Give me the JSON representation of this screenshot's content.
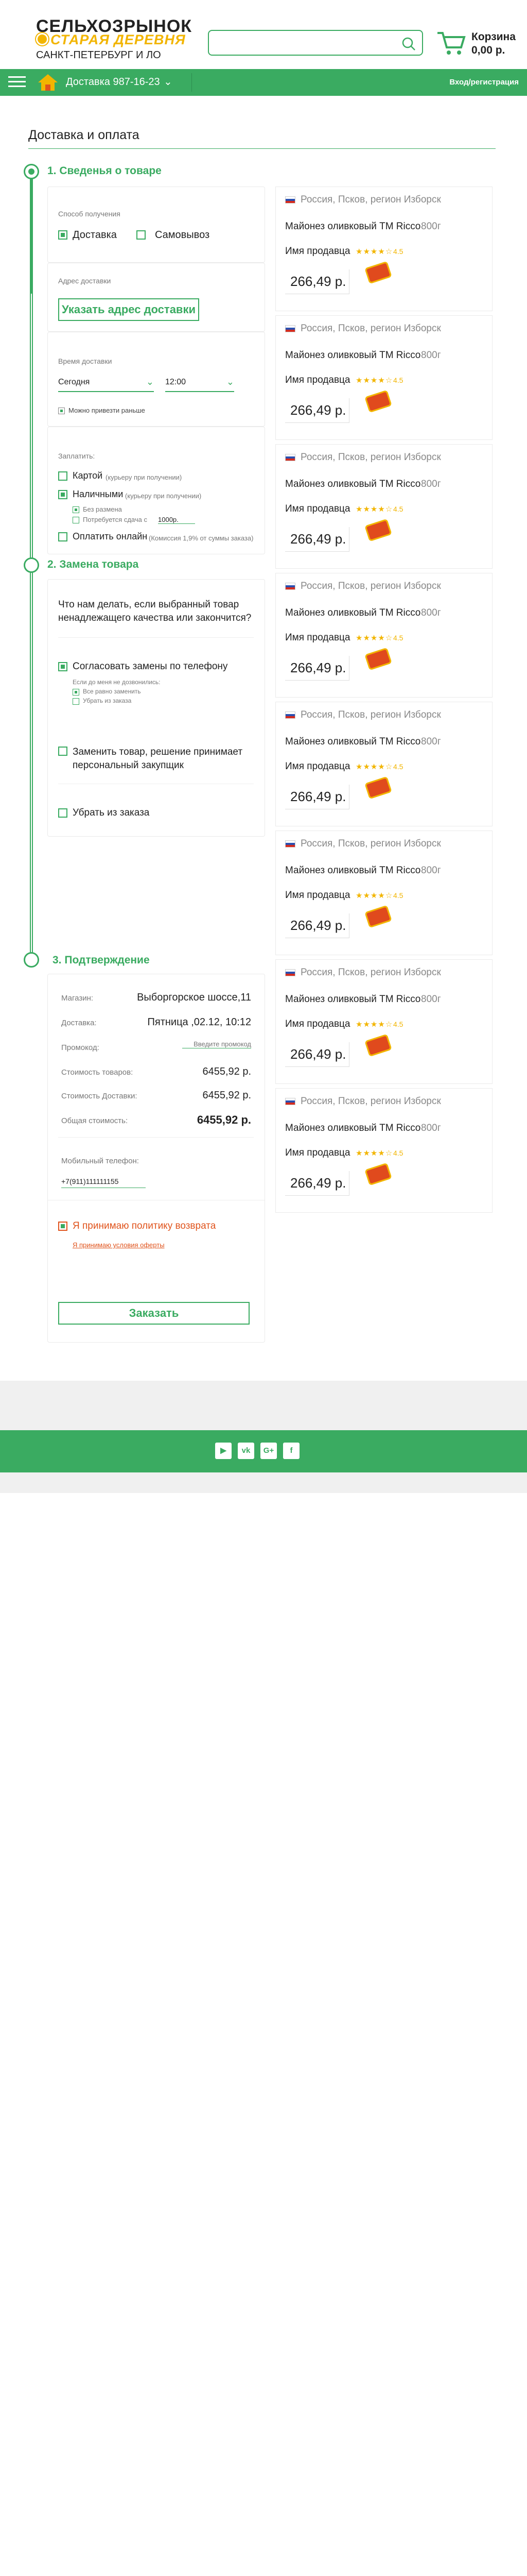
{
  "header": {
    "logo_top": "СЕЛЬХОЗРЫНОК",
    "logo_bottom": "СТАРАЯ ДЕРЕВНЯ",
    "city": "САНКТ-ПЕТЕРБУРГ И ЛО",
    "search_placeholder": "",
    "cart_label": "Корзина",
    "cart_sum": "0,00 р."
  },
  "nav": {
    "delivery": "Доставка  987-16-23",
    "login": "Вход/регистрация"
  },
  "page": {
    "title": "Доставка и оплата"
  },
  "step1": {
    "title": "1. Сведенья о товаре",
    "method_label": "Способ получения",
    "method_delivery": "Доставка",
    "method_pickup": "Самовывоз",
    "address_label": "Адрес доставки",
    "address_button": "Указать адрес доставки",
    "time_label": "Время доставки",
    "day_value": "Сегодня",
    "time_value": "12:00",
    "early_label": "Можно привезти раньше",
    "pay_label": "Заплатить:",
    "pay_card": "Картой",
    "pay_card_note": "(курьеру при получении)",
    "pay_cash": "Наличными",
    "pay_cash_note": "(курьеру при получении)",
    "no_change": "Без размена",
    "need_change": "Потребуется сдача с",
    "change_amount": "1000р.",
    "pay_online": "Оплатить онлайн",
    "pay_online_note": "(Комиссия 1,9% от суммы заказа)"
  },
  "step2": {
    "title": "2. Замена товара",
    "question": "Что нам делать, если выбранный товар ненадлежащего качества или закончится?",
    "opt_agree": "Согласовать замены по телефону",
    "not_reached": "Если до меня не дозвонились:",
    "sub_replace": "Все равно заменить",
    "sub_remove": "Убрать из заказа",
    "opt_replace": "Заменить товар, решение принимает персональный закупщик",
    "opt_remove": "Убрать из заказа"
  },
  "step3": {
    "title": "3. Подтверждение",
    "shop_k": "Магазин:",
    "shop_v": "Выборгорское шоссе,11",
    "delivery_k": "Доставка:",
    "delivery_v": "Пятница ,02.12, 10:12",
    "promo_k": "Промокод:",
    "promo_placeholder": "Введите промокод",
    "goods_k": "Стоимость товаров:",
    "goods_v": "6455,92 р.",
    "deliv_cost_k": "Стоимость Доставки:",
    "deliv_cost_v": "6455,92 р.",
    "total_k": "Общая стоимость:",
    "total_v": "6455,92 р.",
    "phone_label": "Мобильный телефон:",
    "phone_value": "+7(911)111111155",
    "policy": "Я принимаю политику возврата",
    "offer_link": "Я принимаю условия оферты",
    "order_button": "Заказать"
  },
  "product": {
    "origin": "Россия, Псков, регион Изборск",
    "name": "Майонез оливковый ТМ Ricco",
    "weight": "800г",
    "seller": "Имя продавца",
    "rating_stars": 4,
    "rating_text": "4.5",
    "price": "266,49 р."
  },
  "products_count_note": "",
  "footer": {
    "socials": [
      "youtube-icon",
      "vk-icon",
      "google-plus-icon",
      "facebook-icon"
    ],
    "social_labels": [
      "▶",
      "vk",
      "G+",
      "f"
    ]
  },
  "colors": {
    "brand_green": "#3aab61",
    "brand_yellow": "#f2b500",
    "accent_orange": "#e0541d"
  }
}
